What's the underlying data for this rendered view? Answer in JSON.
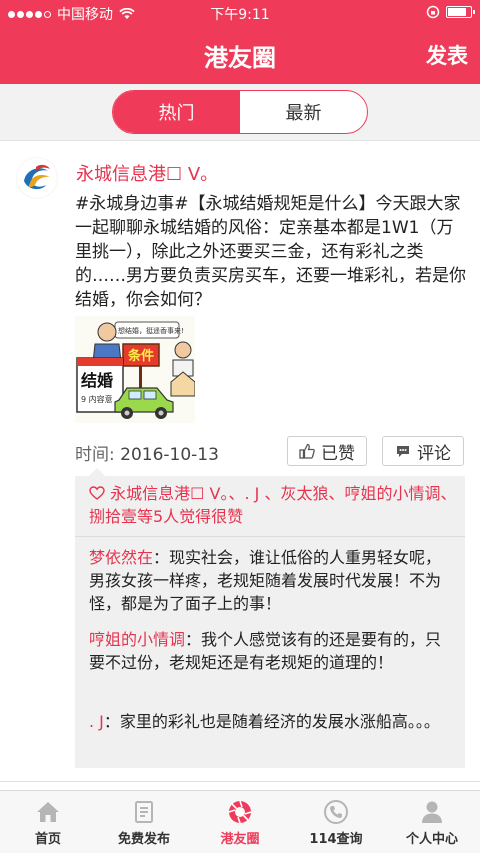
{
  "status_bar": {
    "carrier": "中国移动",
    "time": "下午9:11",
    "battery_level": 0.85
  },
  "nav": {
    "title": "港友圈",
    "publish_label": "发表"
  },
  "segments": {
    "hot": "热门",
    "latest": "最新",
    "selected": "hot"
  },
  "post": {
    "author": "永城信息港☐ V。",
    "text": "#永城身边事#【永城结婚规矩是什么】今天跟大家一起聊聊永城结婚的风俗：定亲基本都是1W1（万里挑一），除此之外还要买三金，还有彩礼之类的……男方要负责买房买车，还要一堆彩礼，若是你结婚，你会如何？",
    "image": {
      "speech_bubble": "想结婚，挺遥香事来!",
      "sign_text": "条件",
      "calendar_text": "结婚",
      "calendar_sub": "9 内容意"
    },
    "time_prefix": "时间:",
    "time_value": "2016-10-13",
    "like_label": "已赞",
    "comment_label": "评论",
    "likes_text": "永城信息港☐ V。、. J 、灰太狼、哼姐的小情调、捌拾壹等5人觉得很赞",
    "comments": [
      {
        "name": "梦依然在",
        "sep": "：",
        "text": "现实社会，谁让低俗的人重男轻女呢，男孩女孩一样疼，老规矩随着发展时代发展！不为怪，都是为了面子上的事！"
      },
      {
        "name": "哼姐的小情调",
        "sep": "：",
        "text": "我个人感觉该有的还是要有的，只要不过份，老规矩还是有老规矩的道理的！"
      },
      {
        "name": ". J",
        "sep": "：",
        "text": "家里的彩礼也是随着经济的发展水涨船高。。。"
      }
    ]
  },
  "tabs": [
    {
      "label": "首页",
      "icon": "home-icon"
    },
    {
      "label": "免费发布",
      "icon": "document-icon"
    },
    {
      "label": "港友圈",
      "icon": "camera-shutter-icon"
    },
    {
      "label": "114查询",
      "icon": "phone-icon"
    },
    {
      "label": "个人中心",
      "icon": "person-icon"
    }
  ],
  "colors": {
    "brand": "#ef3b59",
    "name_red": "#e6344f"
  }
}
